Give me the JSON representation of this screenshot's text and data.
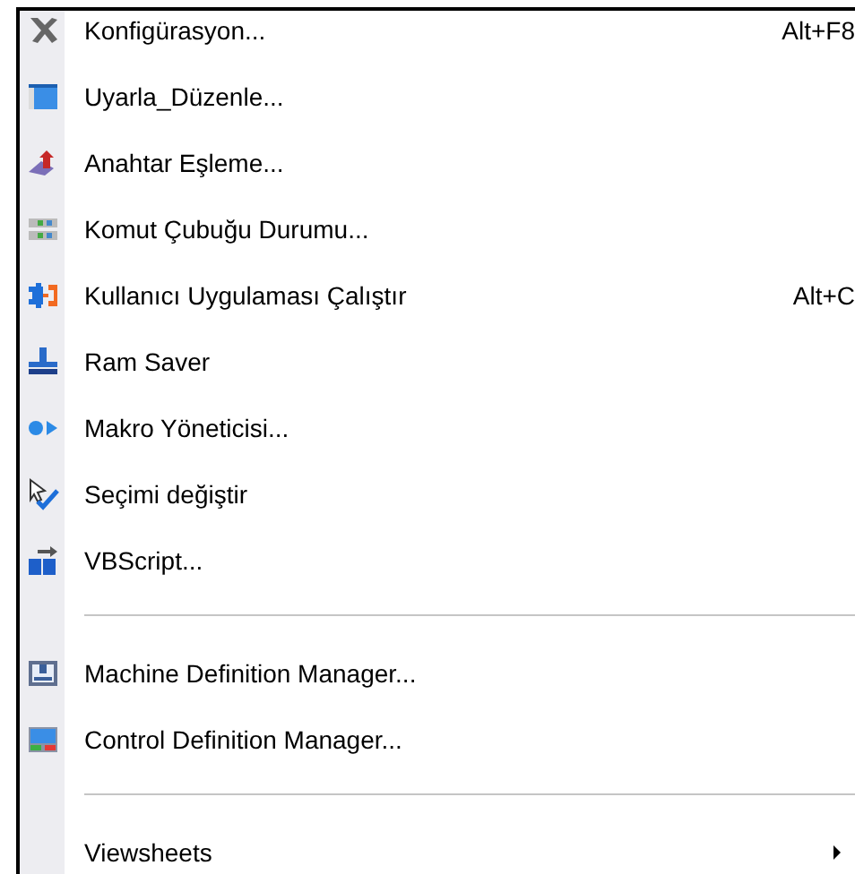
{
  "menu": {
    "items": [
      {
        "kind": "item",
        "label": "Konfigürasyon...",
        "shortcut": "Alt+F8"
      },
      {
        "kind": "item",
        "label": "Uyarla_Düzenle..."
      },
      {
        "kind": "item",
        "label": "Anahtar Eşleme..."
      },
      {
        "kind": "item",
        "label": "Komut Çubuğu Durumu..."
      },
      {
        "kind": "item",
        "label": "Kullanıcı Uygulaması Çalıştır",
        "shortcut": "Alt+C"
      },
      {
        "kind": "item",
        "label": "Ram Saver"
      },
      {
        "kind": "item",
        "label": "Makro Yöneticisi..."
      },
      {
        "kind": "item",
        "label": "Seçimi değiştir"
      },
      {
        "kind": "item",
        "label": "VBScript..."
      },
      {
        "kind": "separator"
      },
      {
        "kind": "item",
        "label": "Machine Definition Manager..."
      },
      {
        "kind": "item",
        "label": "Control Definition Manager..."
      },
      {
        "kind": "separator"
      },
      {
        "kind": "item",
        "label": "Viewsheets",
        "submenu": true
      }
    ]
  }
}
